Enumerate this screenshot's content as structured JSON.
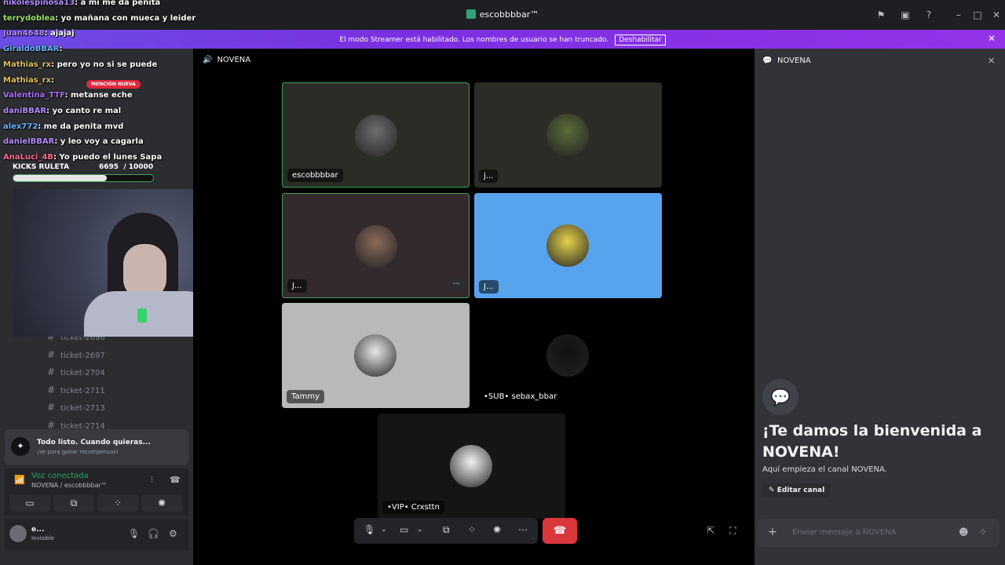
{
  "window": {
    "title": "escobbbbar™"
  },
  "banner": {
    "text": "El modo Streamer está habilitado. Los nombres de usuario se han truncado.",
    "button": "Deshabilitar"
  },
  "chat_overlay": [
    {
      "user": "nikolespinosa13",
      "msg": ": a mi me da penita",
      "color": "#b28cff"
    },
    {
      "user": "terrydoblea",
      "msg": ": yo mañana con mueca y leider",
      "color": "#9be36b"
    },
    {
      "user": "Juan4648",
      "msg": ": ajajaj",
      "color": "#b28cff"
    },
    {
      "user": "GiraldoBBAR",
      "msg": ":",
      "color": "#66b3ff"
    },
    {
      "user": "Mathias_rx",
      "msg": ": pero yo no si se puede",
      "color": "#e0c060"
    },
    {
      "user": "Mathias_rx",
      "msg": ":",
      "color": "#e0c060"
    },
    {
      "user": "Valentina_TTF",
      "msg": ": metanse eche",
      "color": "#b06cff"
    },
    {
      "user": "daniBBAR",
      "msg": ": yo canto re mal",
      "color": "#b28cff"
    },
    {
      "user": "alex772",
      "msg": ": me da penita mvd",
      "color": "#66b3ff"
    },
    {
      "user": "danielBBAR",
      "msg": ": y leo voy a cagarla",
      "color": "#b28cff"
    },
    {
      "user": "AnaLuci_4B",
      "msg": ": Yo puedo el lunes Sapa",
      "color": "#ff6b8a"
    }
  ],
  "mention_badge": "MENCIÓN NUEVA",
  "roulette": {
    "label": "KICKS RULETA",
    "current": "6695",
    "total": "/ 10000",
    "progress": 0.67
  },
  "sidebar": {
    "tickets": [
      "ticket-2696",
      "ticket-2697",
      "ticket-2704",
      "ticket-2711",
      "ticket-2713",
      "ticket-2714"
    ]
  },
  "notification": {
    "title": "Todo listo. Cuando quieras...",
    "subtitle": "¡Ve para ganar recompensas!"
  },
  "voice": {
    "status": "Voz conectada",
    "channel": "NOVENA / escobbbbar™"
  },
  "user": {
    "name": "e...",
    "status": "Invisible"
  },
  "call": {
    "channel": "NOVENA",
    "tiles": [
      {
        "name": "escobbbbar",
        "bg": "#2a2c26",
        "speaking": true,
        "avatar_color": "#6d6d6d"
      },
      {
        "name": "j...",
        "bg": "#2a2c26",
        "speaking": false,
        "avatar_color": "#5b6b3a"
      },
      {
        "name": "J...",
        "bg": "#34292d",
        "speaking": true,
        "avatar_color": "#8a6a5a"
      },
      {
        "name": "J...",
        "bg": "#58a3ee",
        "speaking": false,
        "avatar_color": "#e5d24a"
      },
      {
        "name": "Tammy",
        "bg": "#b9b9b9",
        "speaking": false,
        "avatar_color": "#e8e8e8"
      },
      {
        "name": "•SUB• sebax_bbar",
        "bg": "#000000",
        "speaking": false,
        "avatar_color": "#111111"
      },
      {
        "name": "•VIP• Crxsttn",
        "bg": "#151515",
        "speaking": false,
        "avatar_color": "#f2f2f2"
      }
    ]
  },
  "right_panel": {
    "title": "NOVENA",
    "welcome_title": "¡Te damos la bienvenida a NOVENA!",
    "welcome_sub": "Aquí empieza el canal NOVENA.",
    "edit_button": "Editar canal",
    "input_placeholder": "Enviar mensaje a NOVENA"
  },
  "colors": {
    "speaking_border": "#3ba55c",
    "hangup": "#da373c",
    "banner": "#7b2fe0"
  }
}
